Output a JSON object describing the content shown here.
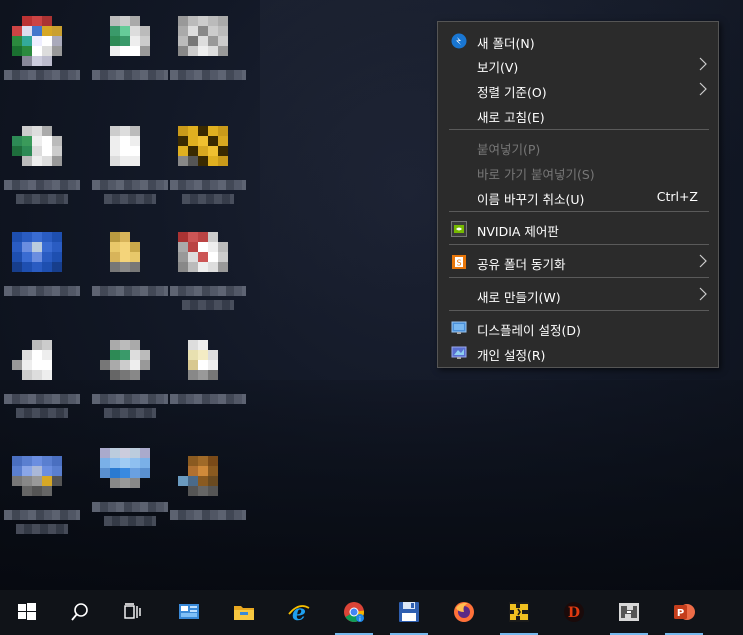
{
  "context_menu": {
    "items": [
      {
        "label": "새 폴더(N)"
      },
      {
        "label": "보기(V)"
      },
      {
        "label": "정렬 기준(O)"
      },
      {
        "label": "새로 고침(E)"
      },
      {
        "label": "붙여넣기(P)"
      },
      {
        "label": "바로 가기 붙여넣기(S)"
      },
      {
        "label": "이름 바꾸기 취소(U)",
        "shortcut": "Ctrl+Z"
      },
      {
        "label": "NVIDIA 제어판"
      },
      {
        "label": "공유 폴더 동기화"
      },
      {
        "label": "새로 만들기(W)"
      },
      {
        "label": "디스플레이 설정(D)"
      },
      {
        "label": "개인 설정(R)"
      }
    ]
  },
  "taskbar": {
    "items": [
      "start",
      "search",
      "task-view",
      "control-panel",
      "file-explorer",
      "internet-explorer",
      "chrome",
      "save",
      "firefox",
      "app-yellow",
      "diablo",
      "app-map",
      "powerpoint"
    ]
  },
  "colors": {
    "menu_bg": "#2b2b2b",
    "taskbar_bg": "#101318",
    "accent": "#76b9ed"
  }
}
